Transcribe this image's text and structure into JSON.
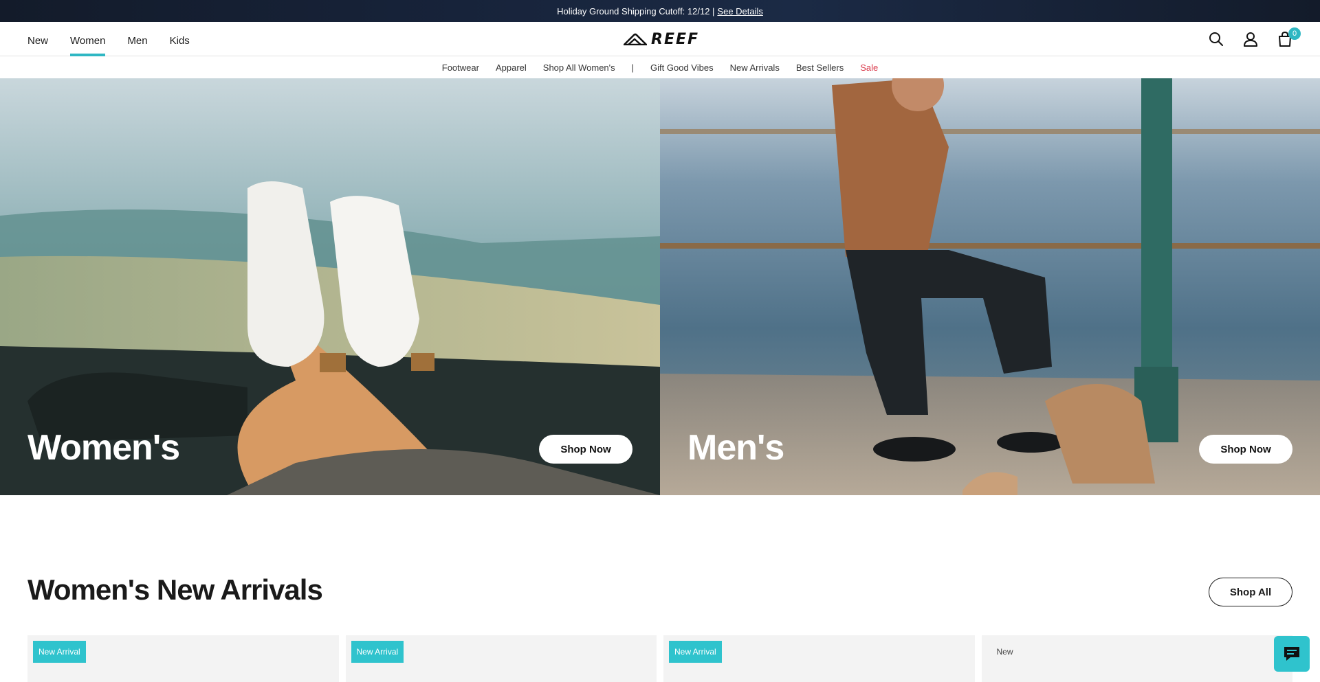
{
  "announcement": {
    "text": "Holiday Ground Shipping Cutoff: 12/12 |",
    "link": "See Details"
  },
  "header": {
    "nav": [
      {
        "label": "New",
        "active": false
      },
      {
        "label": "Women",
        "active": true
      },
      {
        "label": "Men",
        "active": false
      },
      {
        "label": "Kids",
        "active": false
      }
    ],
    "logo_text": "REEF",
    "icons": [
      "search-icon",
      "account-icon",
      "cart-icon"
    ],
    "cart_count": "0"
  },
  "subnav": {
    "items": [
      "Footwear",
      "Apparel",
      "Shop All Women's"
    ],
    "separator": "|",
    "items2": [
      "Gift Good Vibes",
      "New Arrivals",
      "Best Sellers"
    ],
    "sale": "Sale",
    "sale_color": "#d9394a"
  },
  "hero": {
    "women": {
      "title": "Women's",
      "button": "Shop Now"
    },
    "men": {
      "title": "Men's",
      "button": "Shop Now"
    }
  },
  "section": {
    "title": "Women's New Arrivals",
    "button": "Shop All"
  },
  "products": [
    {
      "badge": "New Arrival"
    },
    {
      "badge": "New Arrival"
    },
    {
      "badge": "New Arrival"
    },
    {
      "badge": "New"
    }
  ],
  "colors": {
    "accent": "#2fb7c3",
    "badge": "#2fc3cd",
    "announcement_bg": "#17233a"
  }
}
